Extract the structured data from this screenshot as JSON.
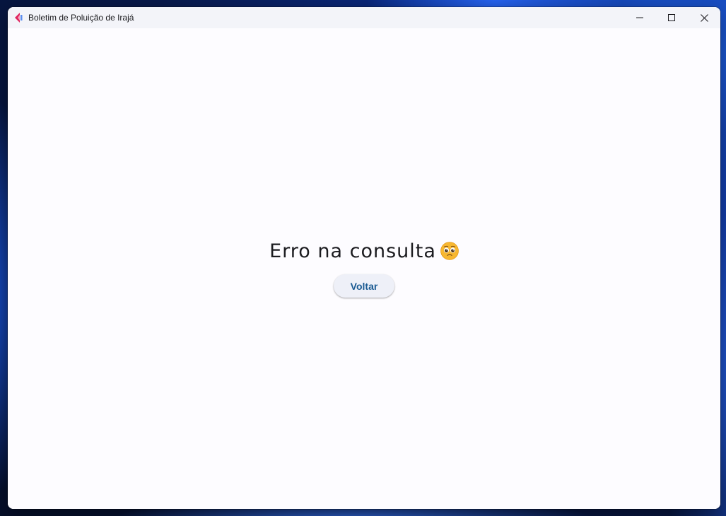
{
  "window": {
    "title": "Boletim de Poluição de Irajá",
    "app_icon": "app-logo-icon",
    "controls": {
      "minimize_icon": "minimize-icon",
      "maximize_icon": "maximize-icon",
      "close_icon": "close-icon"
    }
  },
  "main": {
    "message": "Erro na consulta",
    "message_emoji": "pleading-face-icon",
    "back_button_label": "Voltar"
  },
  "colors": {
    "accent": "#1b5b93",
    "background": "#fdfcff",
    "titlebar": "#f3f4f9",
    "app_icon_red": "#e0245e",
    "app_icon_blue": "#5b8def"
  }
}
